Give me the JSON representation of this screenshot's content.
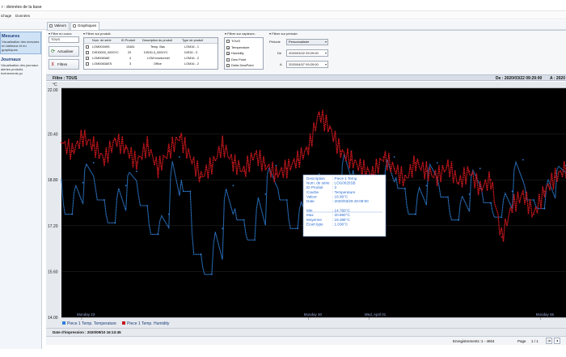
{
  "window": {
    "title": "r : données de la base"
  },
  "menu": [
    "ichage",
    "Données"
  ],
  "sidebar": {
    "sections": [
      {
        "title": "Mesures",
        "lines": [
          "Visualisation des mesures",
          "en tableaux et en",
          "graphiques"
        ]
      },
      {
        "title": "Journaux",
        "lines": [
          "Visualisation des journaux",
          "alertes produits",
          "événements pc"
        ]
      }
    ]
  },
  "tabs": [
    {
      "label": "Valeurs"
    },
    {
      "label": "Graphiques"
    }
  ],
  "filters": {
    "en_cours": {
      "label": "Filtre en cours",
      "value": "TOUS",
      "refresh_label": "Actualiser",
      "filter_button": "Filtres"
    },
    "produits": {
      "label": "Filtrer sur produit:",
      "columns": [
        "Num. de série",
        "ID Produit",
        "Description du produit",
        "Type de produit"
      ],
      "rows": [
        [
          "LOM0034H5",
          "13481",
          "Temp. Bas",
          "LOM16 - 1"
        ],
        [
          "DIS30000_0000YC",
          "20",
          "DIS30-3_0000YC",
          "DIS30 - 3"
        ],
        [
          "LOM0060AE",
          "4",
          "LOM fonctionnel",
          "LOM16 - 2"
        ],
        [
          "LOM0060AES",
          "3",
          "Office",
          "LOM16 - 2"
        ]
      ]
    },
    "capteurs": {
      "label": "Filtrer sur capteurs:",
      "items": [
        {
          "label": "TOUS",
          "checked": false
        },
        {
          "label": "Temperature",
          "checked": true
        },
        {
          "label": "Humidity",
          "checked": true
        },
        {
          "label": "Dew Point",
          "checked": false
        },
        {
          "label": "Delta DewPoint",
          "checked": false
        }
      ]
    },
    "periode": {
      "label": "Filtrer sur période:",
      "periode_label": "Période",
      "periode_value": "Personnalisée",
      "de_label": "De",
      "de_value": "2020/03/22 09:29:00",
      "a_label": "A",
      "a_value": "2020/04/07 09:29:00"
    }
  },
  "filterbar": {
    "filtre": "Filtre : TOUS",
    "de": "De : 2020/03/22 09:29:00",
    "a": "A : 2020"
  },
  "chart_data": {
    "type": "line",
    "ylabel": "°C",
    "yticks": [
      "22.00",
      "20.40",
      "18.80",
      "17.20",
      "15.60",
      "14.00"
    ],
    "ylim": [
      14.0,
      22.0
    ],
    "xticks": [
      "Monday 23",
      "Monday 30",
      "Wed, April 01",
      "Monday 06"
    ],
    "background": "#000000",
    "series": [
      {
        "name": "Piece 1 Temp. Temperature",
        "color": "#2e7fd6",
        "pattern": "sawtooth",
        "values": [
          18.8,
          17.6,
          18.7,
          19.4,
          18.1,
          17.3,
          18.6,
          19.1,
          17.9,
          16.9,
          17.6,
          19.6,
          18.4,
          16.2,
          15.5,
          17.1,
          18.6,
          17.4,
          16.7,
          18.3,
          19.3,
          18.1,
          17.1,
          18.1,
          19.0,
          17.7,
          18.4,
          19.8,
          18.8,
          17.3,
          18.3,
          19.6,
          18.5,
          17.6,
          18.6,
          19.4,
          18.2,
          17.4,
          18.3,
          19.2,
          18.0,
          17.5,
          18.4,
          19.5,
          18.1,
          17.8,
          18.9,
          19.3
        ]
      },
      {
        "name": "Piece 1 Temp. Humidity",
        "color": "#c3161c",
        "pattern": "noisy",
        "values": [
          20.1,
          19.8,
          20.3,
          20.0,
          19.5,
          20.2,
          19.9,
          19.4,
          20.0,
          19.2,
          19.8,
          20.3,
          19.6,
          18.9,
          19.3,
          20.0,
          19.4,
          19.1,
          19.7,
          19.3,
          19.0,
          19.2,
          19.5,
          19.9,
          21.1,
          20.6,
          19.8,
          19.5,
          19.2,
          19.0,
          19.6,
          19.2,
          18.8,
          19.4,
          19.1,
          18.9,
          19.3,
          18.7,
          19.1,
          18.5,
          18.8,
          16.8,
          17.9,
          18.3,
          17.6,
          18.4,
          18.9,
          19.2
        ]
      }
    ],
    "legend": "bottom-left",
    "tooltip": {
      "lines": [
        [
          "Description",
          ": Piece 1 Temp."
        ],
        [
          "Num. de série",
          ": LOG0025SB"
        ],
        [
          "ID Produit",
          ": 3"
        ],
        [
          "Courbe",
          ": Temperature"
        ],
        [
          "Valeur",
          ": 18.99°C"
        ],
        [
          "Date",
          ": 2020/03/29 20:09:00"
        ],
        [
          "Min",
          ": 14.760°C"
        ],
        [
          "Max",
          ": 20.860°C"
        ],
        [
          "Moyenne",
          ": 18.386°C"
        ],
        [
          "Ecart type",
          ": 1.036°C"
        ]
      ]
    }
  },
  "status": {
    "printed": "Date d'impression : 2020/09/10 16:13:45"
  },
  "pager": {
    "records_label": "Enregistrements :",
    "records_value": "1 - 4604",
    "page_label": "Page",
    "page_value": "1 / 1"
  }
}
